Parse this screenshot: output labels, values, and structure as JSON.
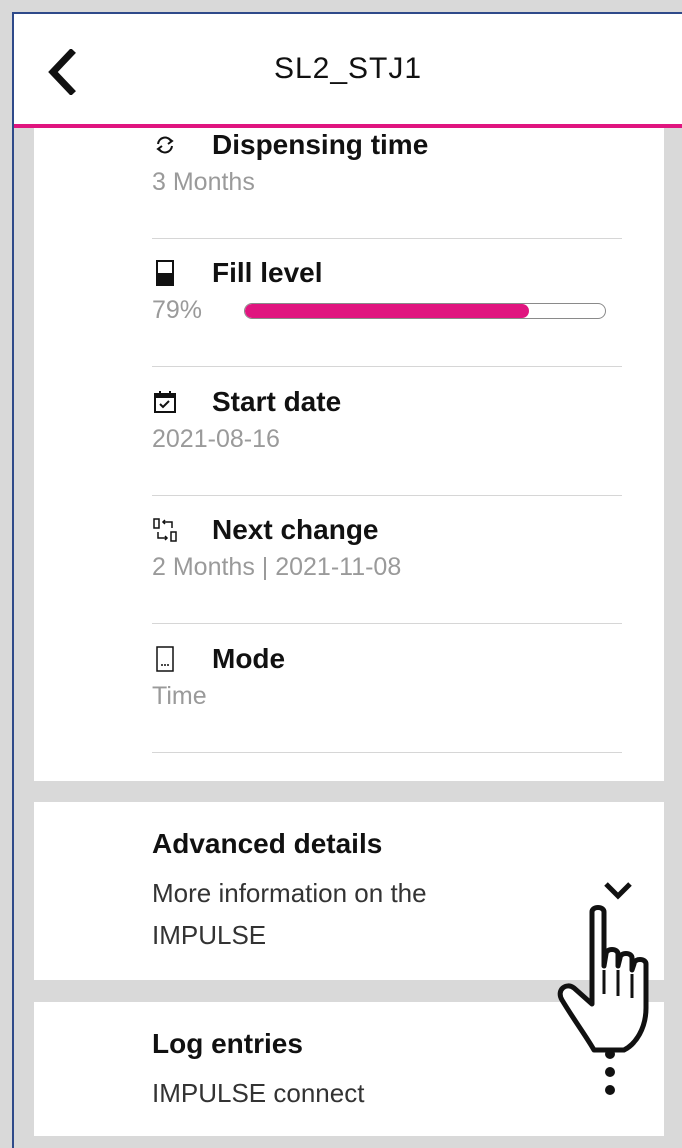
{
  "header": {
    "title": "SL2_STJ1",
    "back_icon": "chevron-left-icon"
  },
  "details": [
    {
      "icon": "refresh-icon",
      "label": "Dispensing time",
      "value": "3 Months"
    },
    {
      "icon": "battery-icon",
      "label": "Fill level",
      "value": "79%",
      "fill_level": 0.79
    },
    {
      "icon": "calendar-check-icon",
      "label": "Start date",
      "value": "2021-08-16"
    },
    {
      "icon": "swap-icon",
      "label": "Next change",
      "value": "2 Months | 2021-11-08"
    },
    {
      "icon": "device-icon",
      "label": "Mode",
      "value": "Time"
    }
  ],
  "advanced": {
    "title": "Advanced details",
    "subtitle": "More information on the IMPULSE",
    "icon": "chevron-down-icon"
  },
  "log": {
    "title": "Log entries",
    "subtitle": "IMPULSE connect",
    "icon": "more-vertical-icon"
  },
  "colors": {
    "accent": "#e0157f",
    "background": "#d9d9d9",
    "muted_text": "#9a9a9a"
  }
}
